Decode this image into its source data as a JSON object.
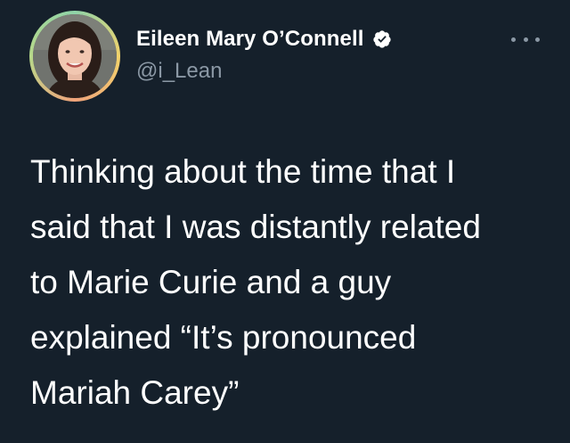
{
  "tweet": {
    "author": {
      "display_name": "Eileen Mary O’Connell",
      "handle": "@i_Lean",
      "verified": true,
      "avatar_icon": "profile-photo"
    },
    "more_icon": "more-horizontal-icon",
    "text_lines": [
      "Thinking about the time that I",
      "said that I was distantly related",
      "to Marie Curie and a guy",
      "explained “It’s pronounced",
      "Mariah Carey”"
    ]
  },
  "colors": {
    "background": "#15202b",
    "text_primary": "#ffffff",
    "text_secondary": "#8b98a5",
    "verified_badge": "#ffffff"
  }
}
